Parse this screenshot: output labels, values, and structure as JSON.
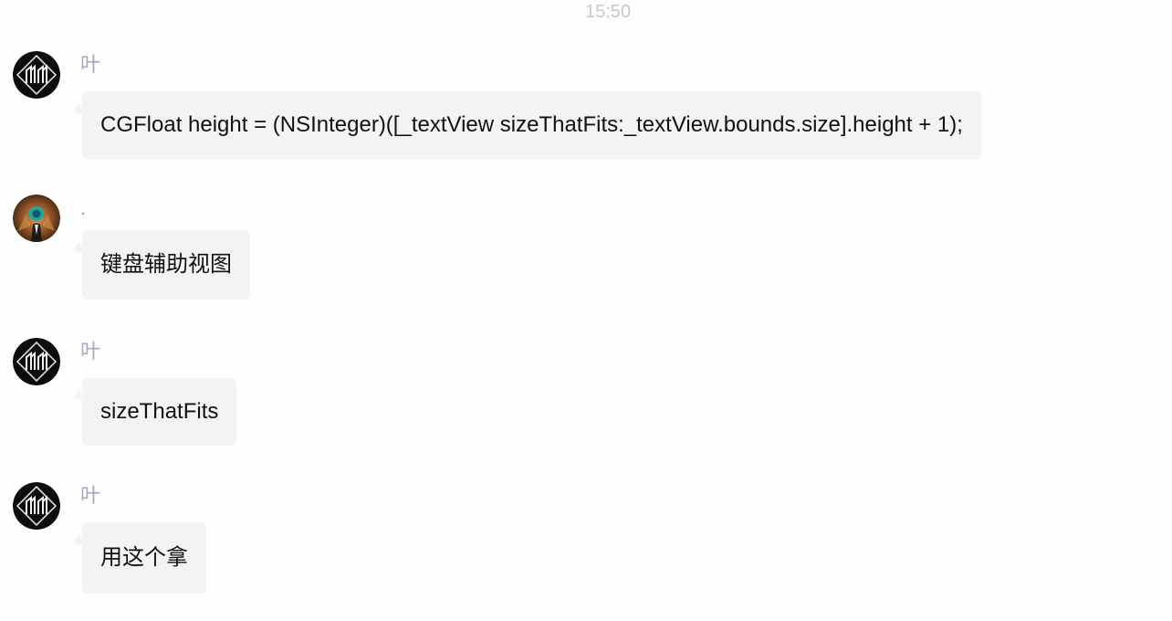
{
  "timestamp": "15:50",
  "messages": [
    {
      "sender": "叶",
      "avatar": "dark-monogram-avatar",
      "text": "CGFloat height = (NSInteger)([_textView sizeThatFits:_textView.bounds.size].height + 1);"
    },
    {
      "sender": ".",
      "avatar": "photo-avatar",
      "text": "键盘辅助视图"
    },
    {
      "sender": "叶",
      "avatar": "dark-monogram-avatar",
      "text": "sizeThatFits"
    },
    {
      "sender": "叶",
      "avatar": "dark-monogram-avatar",
      "text": "用这个拿"
    }
  ],
  "colors": {
    "background": "#fefefe",
    "bubble": "#f3f3f3",
    "sender_name": "#a1a9c4",
    "timestamp": "#c8c8c8",
    "message_text": "#111111"
  }
}
